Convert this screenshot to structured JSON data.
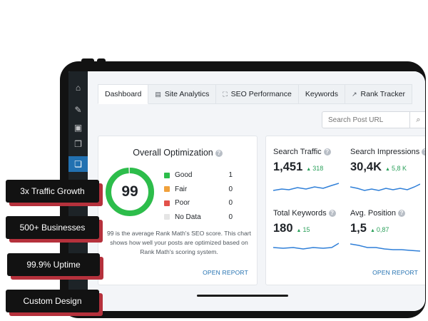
{
  "tabs": [
    {
      "label": "Dashboard",
      "icon": ""
    },
    {
      "label": "Site Analytics",
      "icon": "calendar-icon"
    },
    {
      "label": "SEO Performance",
      "icon": "scan-icon"
    },
    {
      "label": "Keywords",
      "icon": ""
    },
    {
      "label": "Rank Tracker",
      "icon": "trend-icon"
    }
  ],
  "search": {
    "placeholder": "Search Post URL"
  },
  "optimization": {
    "title": "Overall Optimization",
    "score": "99",
    "score_fraction": 0.99,
    "legend": [
      {
        "label": "Good",
        "count": "1",
        "color": "#2dbd4b"
      },
      {
        "label": "Fair",
        "count": "0",
        "color": "#f0a13c"
      },
      {
        "label": "Poor",
        "count": "0",
        "color": "#e2514a"
      },
      {
        "label": "No Data",
        "count": "0",
        "color": "#e5e5e5"
      }
    ],
    "description": "99 is the average Rank Math's SEO score. This chart shows how well your posts are optimized based on Rank Math's scoring system.",
    "open_report": "OPEN REPORT"
  },
  "metrics": {
    "search_traffic": {
      "label": "Search Traffic",
      "value": "1,451",
      "change": "318"
    },
    "search_impressions": {
      "label": "Search Impressions",
      "value": "30,4K",
      "change": "5,8 K"
    },
    "total_keywords": {
      "label": "Total Keywords",
      "value": "180",
      "change": "15"
    },
    "avg_position": {
      "label": "Avg. Position",
      "value": "1,5",
      "change": "0,87"
    },
    "open_report": "OPEN REPORT"
  },
  "sidebar_icons": [
    "home-icon",
    "pin-icon",
    "media-icon",
    "pages-icon",
    "posts-icon"
  ],
  "badges": {
    "traffic": "3x Traffic Growth",
    "businesses": "500+ Businesses",
    "uptime": "99.9% Uptime",
    "design": "Custom Design"
  },
  "colors": {
    "accent": "#2271b1",
    "good": "#2dbd4b",
    "badge_shadow": "#b5313c",
    "spark": "#2f7fd8"
  }
}
